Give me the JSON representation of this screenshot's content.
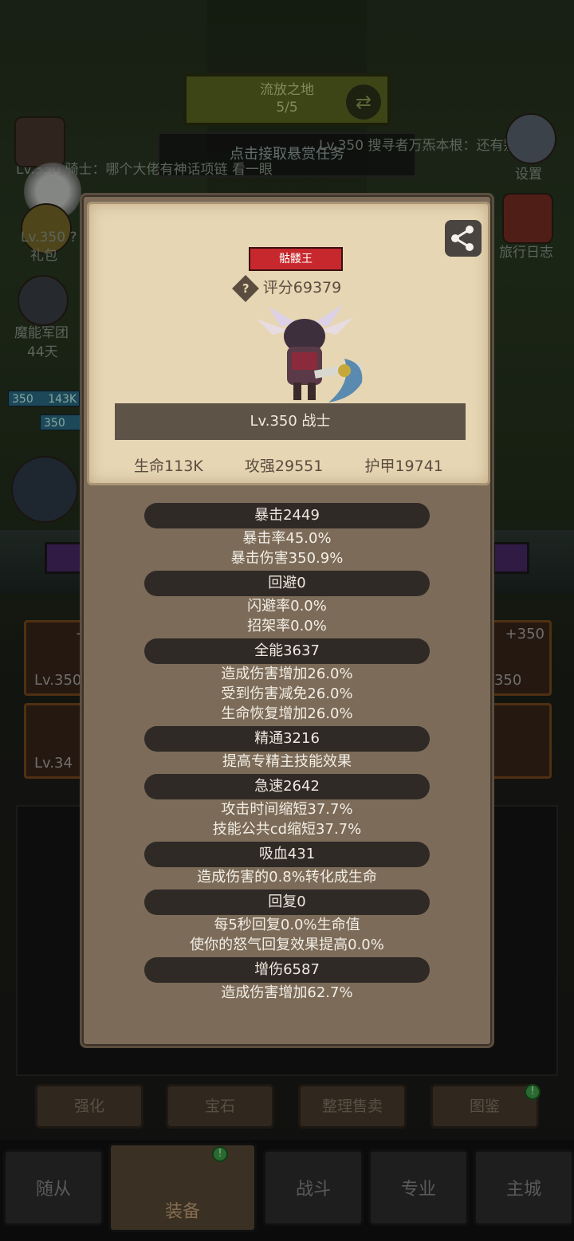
{
  "background": {
    "zone_title": "流放之地",
    "zone_progress": "5/5",
    "bounty_button": "点击接取悬赏任务",
    "chat_left": "Lv.350 骑士：哪个大佬有神话项链 看一眼",
    "chat_right": "Lv.350 搜寻者万炁本根：还有别的,",
    "left_icons": [
      {
        "label": "礼包"
      },
      {
        "label": "魔能军团"
      },
      {
        "label": "44天"
      }
    ],
    "right_icons": [
      {
        "label": "设置"
      },
      {
        "label": "旅行日志"
      }
    ],
    "partial_level_left": "Lv.350 ?",
    "hp_mini_1": "143K",
    "hp_mini_lv_1": "350",
    "hp_mini_lv_2": "350",
    "equip_slots": [
      {
        "level": "Lv.350",
        "plus": "+3"
      },
      {
        "level": "Lv.34",
        "plus": ""
      },
      {
        "level": "v.350",
        "plus": "+350"
      }
    ],
    "tool_buttons": [
      "强化",
      "宝石",
      "整理售卖",
      "图鉴"
    ],
    "nav": [
      "随从",
      "装备",
      "战斗",
      "专业",
      "主城"
    ],
    "badge_mark": "!"
  },
  "card": {
    "title": "骷髅王",
    "score": "评分69379",
    "help_mark": "?",
    "class_line": "Lv.350 战士",
    "base_stats": [
      "生命113K",
      "攻强29551",
      "护甲19741"
    ]
  },
  "stats": [
    {
      "head": "暴击2449",
      "desc": [
        "暴击率45.0%",
        "暴击伤害350.9%"
      ]
    },
    {
      "head": "回避0",
      "desc": [
        "闪避率0.0%",
        "招架率0.0%"
      ]
    },
    {
      "head": "全能3637",
      "desc": [
        "造成伤害增加26.0%",
        "受到伤害减免26.0%",
        "生命恢复增加26.0%"
      ]
    },
    {
      "head": "精通3216",
      "desc": [
        "提高专精主技能效果"
      ]
    },
    {
      "head": "急速2642",
      "desc": [
        "攻击时间缩短37.7%",
        "技能公共cd缩短37.7%"
      ]
    },
    {
      "head": "吸血431",
      "desc": [
        "造成伤害的0.8%转化成生命"
      ]
    },
    {
      "head": "回复0",
      "desc": [
        "每5秒回复0.0%生命值",
        "使你的怒气回复效果提高0.0%"
      ]
    },
    {
      "head": "增伤6587",
      "desc": [
        "造成伤害增加62.7%"
      ]
    }
  ]
}
